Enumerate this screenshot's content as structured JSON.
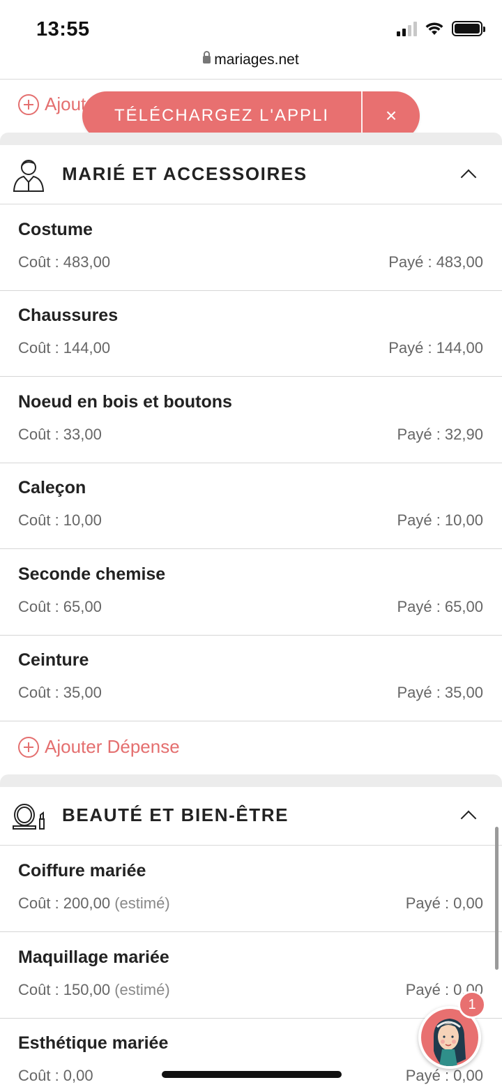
{
  "status_bar": {
    "time": "13:55"
  },
  "browser": {
    "url": "mariages.net"
  },
  "top_add": {
    "label": "Ajouter Dépense"
  },
  "banner": {
    "label": "TÉLÉCHARGEZ L'APPLI",
    "close": "×"
  },
  "sections": [
    {
      "title": "MARIÉ ET ACCESSOIRES",
      "icon": "groom-icon",
      "add_label": "Ajouter Dépense",
      "items": [
        {
          "name": "Costume",
          "cost": "Coût : 483,00",
          "paid": "Payé : 483,00"
        },
        {
          "name": "Chaussures",
          "cost": "Coût : 144,00",
          "paid": "Payé : 144,00"
        },
        {
          "name": "Noeud en bois et boutons",
          "cost": "Coût : 33,00",
          "paid": "Payé : 32,90"
        },
        {
          "name": "Caleçon",
          "cost": "Coût : 10,00",
          "paid": "Payé : 10,00"
        },
        {
          "name": "Seconde chemise",
          "cost": "Coût : 65,00",
          "paid": "Payé : 65,00"
        },
        {
          "name": "Ceinture",
          "cost": "Coût : 35,00",
          "paid": "Payé : 35,00"
        }
      ]
    },
    {
      "title": "BEAUTÉ ET BIEN-ÊTRE",
      "icon": "mirror-lipstick-icon",
      "items": [
        {
          "name": "Coiffure mariée",
          "cost": "Coût : 200,00",
          "estimate": "(estimé)",
          "paid": "Payé : 0,00"
        },
        {
          "name": "Maquillage mariée",
          "cost": "Coût : 150,00",
          "estimate": "(estimé)",
          "paid": "Payé : 0,00"
        },
        {
          "name": "Esthétique mariée",
          "cost": "Coût : 0,00",
          "paid": "Payé : 0,00"
        }
      ]
    }
  ],
  "chat": {
    "badge": "1"
  },
  "colors": {
    "accent": "#e87070",
    "text": "#222222",
    "muted": "#666666"
  }
}
